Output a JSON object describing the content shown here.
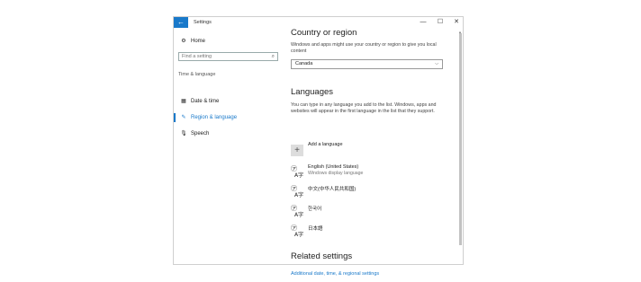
{
  "window": {
    "title": "Settings",
    "back_glyph": "←",
    "minimize_glyph": "—",
    "maximize_glyph": "☐",
    "close_glyph": "✕"
  },
  "sidebar": {
    "home_label": "Home",
    "search_placeholder": "Find a setting",
    "section_label": "Time & language",
    "items": [
      {
        "label": "Date & time",
        "icon": "calendar-clock-icon",
        "active": false
      },
      {
        "label": "Region & language",
        "icon": "language-icon",
        "active": true
      },
      {
        "label": "Speech",
        "icon": "microphone-icon",
        "active": false
      }
    ]
  },
  "region": {
    "title": "Country or region",
    "description": "Windows and apps might use your country or region to give you local content",
    "selected_country": "Canada"
  },
  "languages": {
    "title": "Languages",
    "description": "You can type in any language you add to the list. Windows, apps and websites will appear in the first language in the list that they support.",
    "add_label": "Add a language",
    "items": [
      {
        "name": "English (United States)",
        "sub": "Windows display language"
      },
      {
        "name": "中文(中华人民共和国)",
        "sub": ""
      },
      {
        "name": "한국어",
        "sub": ""
      },
      {
        "name": "日本語",
        "sub": ""
      }
    ]
  },
  "related": {
    "title": "Related settings",
    "link": "Additional date, time, & regional settings"
  },
  "colors": {
    "accent": "#1979ca"
  }
}
